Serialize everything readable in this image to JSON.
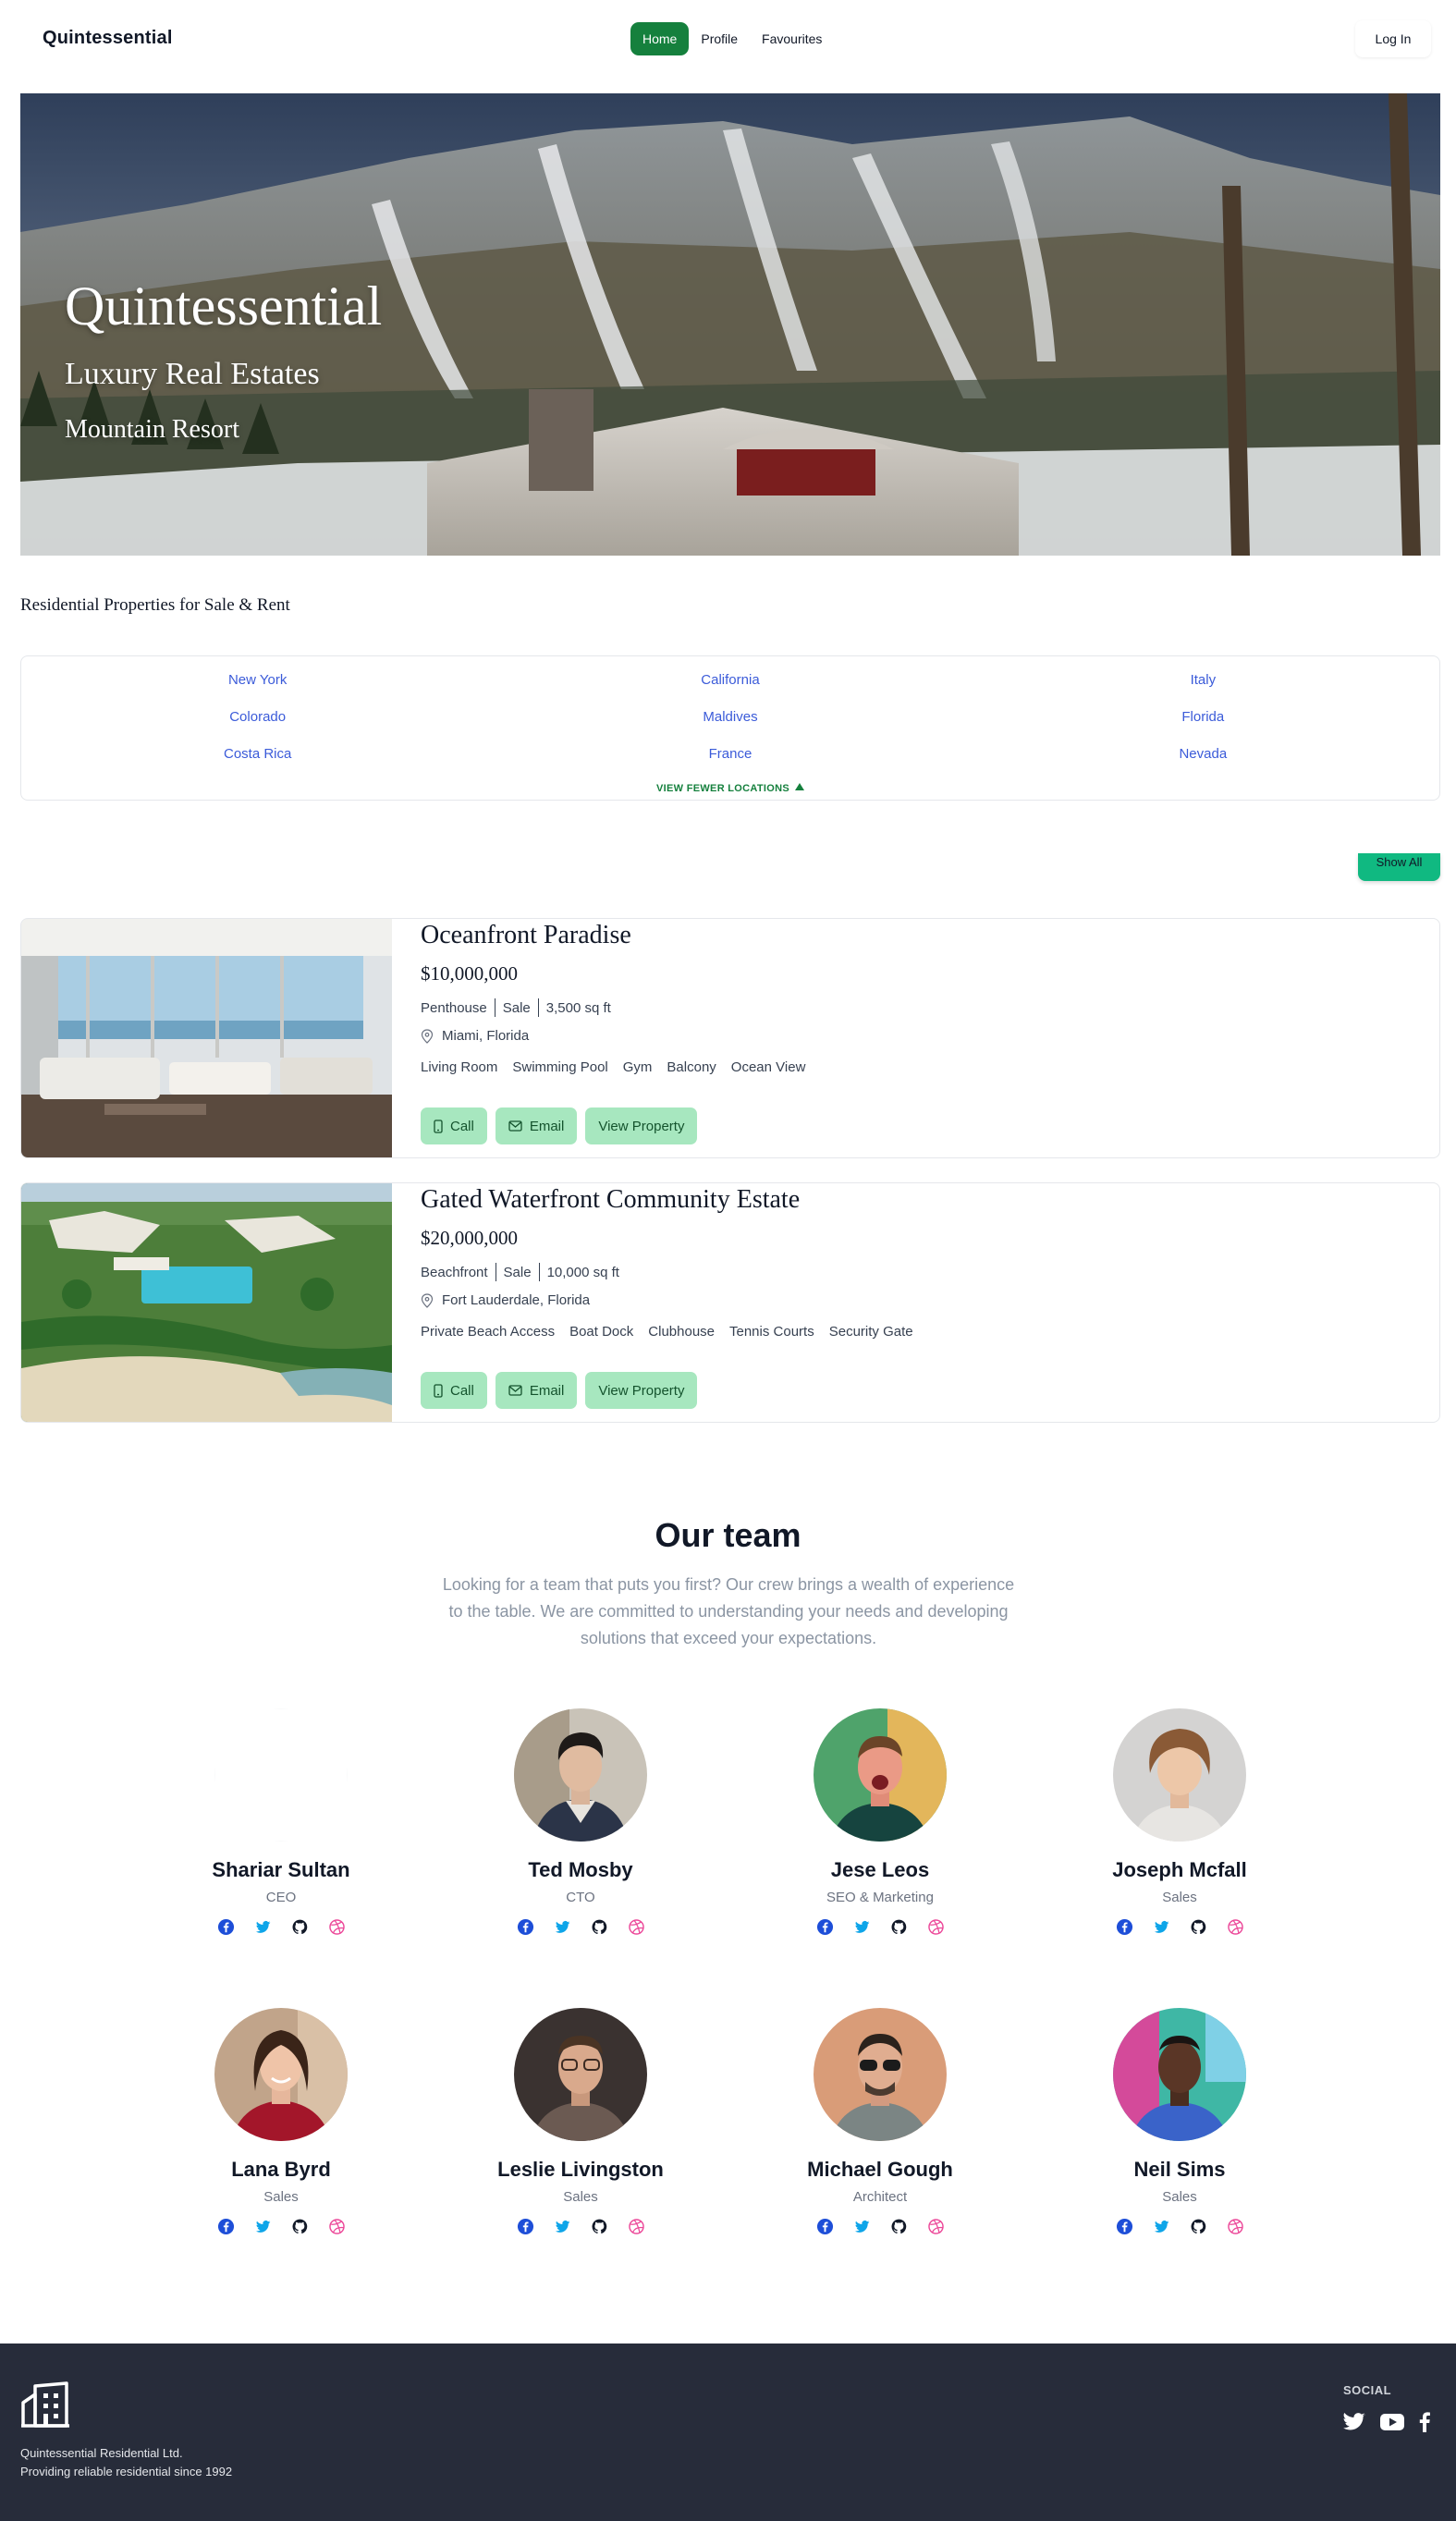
{
  "nav": {
    "brand": "Quintessential",
    "links": [
      {
        "label": "Home",
        "active": true
      },
      {
        "label": "Profile",
        "active": false
      },
      {
        "label": "Favourites",
        "active": false
      }
    ],
    "login_label": "Log In"
  },
  "hero": {
    "title": "Quintessential",
    "subtitle": "Luxury Real Estates",
    "subtitle2": "Mountain Resort"
  },
  "section_heading": "Residential Properties for Sale & Rent",
  "locations": {
    "items": [
      "New York",
      "California",
      "Italy",
      "Colorado",
      "Maldives",
      "Florida",
      "Costa Rica",
      "France",
      "Nevada"
    ],
    "toggle_label": "VIEW FEWER LOCATIONS"
  },
  "show_all_label": "Show All",
  "listings": [
    {
      "title": "Oceanfront Paradise",
      "price": "$10,000,000",
      "type": "Penthouse",
      "status": "Sale",
      "size": "3,500 sq ft",
      "location": "Miami, Florida",
      "features": [
        "Living Room",
        "Swimming Pool",
        "Gym",
        "Balcony",
        "Ocean View"
      ],
      "actions": {
        "call": "Call",
        "email": "Email",
        "view": "View Property"
      }
    },
    {
      "title": "Gated Waterfront Community Estate",
      "price": "$20,000,000",
      "type": "Beachfront",
      "status": "Sale",
      "size": "10,000 sq ft",
      "location": "Fort Lauderdale, Florida",
      "features": [
        "Private Beach Access",
        "Boat Dock",
        "Clubhouse",
        "Tennis Courts",
        "Security Gate"
      ],
      "actions": {
        "call": "Call",
        "email": "Email",
        "view": "View Property"
      }
    }
  ],
  "team": {
    "title": "Our team",
    "description": "Looking for a team that puts you first? Our crew brings a wealth of experience to the table. We are committed to understanding your needs and developing solutions that exceed your expectations.",
    "members": [
      {
        "name": "Shariar Sultan",
        "role": "CEO"
      },
      {
        "name": "Ted Mosby",
        "role": "CTO"
      },
      {
        "name": "Jese Leos",
        "role": "SEO & Marketing"
      },
      {
        "name": "Joseph Mcfall",
        "role": "Sales"
      },
      {
        "name": "Lana Byrd",
        "role": "Sales"
      },
      {
        "name": "Leslie Livingston",
        "role": "Sales"
      },
      {
        "name": "Michael Gough",
        "role": "Architect"
      },
      {
        "name": "Neil Sims",
        "role": "Sales"
      }
    ],
    "social_icons": [
      "facebook-icon",
      "twitter-icon",
      "github-icon",
      "dribbble-icon"
    ]
  },
  "footer": {
    "company": "Quintessential Residential Ltd.",
    "tagline": "Providing reliable residential since 1992",
    "social_heading": "SOCIAL",
    "social_icons": [
      "twitter-icon",
      "youtube-icon",
      "facebook-icon"
    ]
  },
  "colors": {
    "brand_green": "#15803d",
    "button_green": "#a7e7bf",
    "show_all_green": "#10b981",
    "link_blue": "#3b5bd9",
    "footer_bg": "#272c3a"
  }
}
